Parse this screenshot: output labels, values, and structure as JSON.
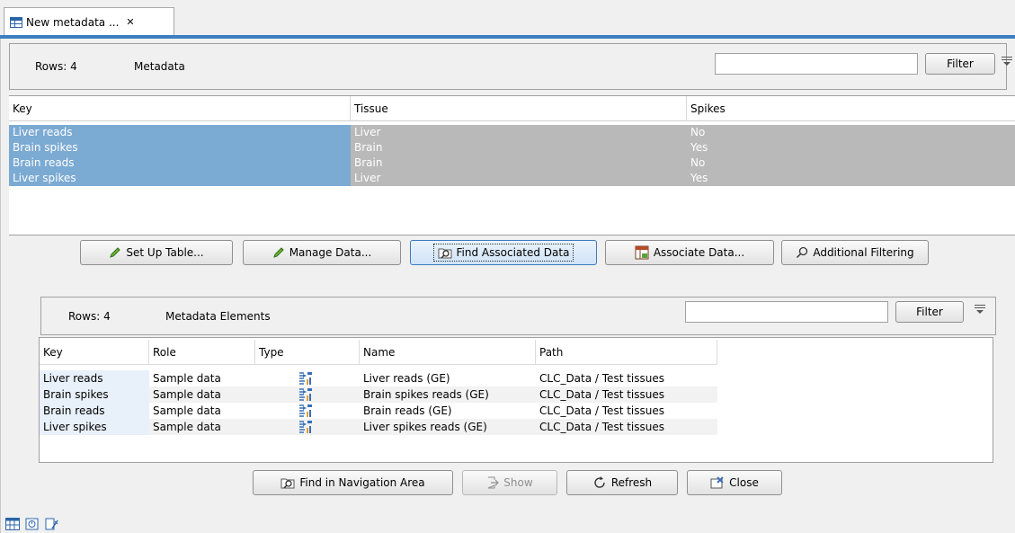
{
  "tab": {
    "title": "New metadata ...",
    "close": "✕"
  },
  "top": {
    "rows_label": "Rows: 4",
    "section_title": "Metadata",
    "filter_value": "",
    "filter_button": "Filter",
    "columns": [
      "Key",
      "Tissue",
      "Spikes"
    ],
    "rows": [
      [
        "Liver reads",
        "Liver",
        "No"
      ],
      [
        "Brain spikes",
        "Brain",
        "Yes"
      ],
      [
        "Brain reads",
        "Brain",
        "No"
      ],
      [
        "Liver spikes",
        "Liver",
        "Yes"
      ]
    ]
  },
  "actions": {
    "set_up_table": "Set Up Table...",
    "manage_data": "Manage Data...",
    "find_associated": "Find Associated Data",
    "associate_data": "Associate Data...",
    "additional_filtering": "Additional Filtering"
  },
  "lower": {
    "rows_label": "Rows: 4",
    "section_title": "Metadata Elements",
    "filter_value": "",
    "filter_button": "Filter",
    "columns": [
      "Key",
      "Role",
      "Type",
      "Name",
      "Path"
    ],
    "rows": [
      {
        "key": "Liver reads",
        "role": "Sample data",
        "type_icon": "sequence-list-icon",
        "name": "Liver reads (GE)",
        "path": "CLC_Data / Test tissues"
      },
      {
        "key": "Brain spikes",
        "role": "Sample data",
        "type_icon": "sequence-list-icon",
        "name": "Brain spikes reads (GE)",
        "path": "CLC_Data / Test tissues"
      },
      {
        "key": "Brain reads",
        "role": "Sample data",
        "type_icon": "sequence-list-icon",
        "name": "Brain reads (GE)",
        "path": "CLC_Data / Test tissues"
      },
      {
        "key": "Liver spikes",
        "role": "Sample data",
        "type_icon": "sequence-list-icon",
        "name": "Liver spikes reads (GE)",
        "path": "CLC_Data / Test tissues"
      }
    ],
    "buttons": {
      "find_nav": "Find in Navigation Area",
      "show": "Show",
      "refresh": "Refresh",
      "close": "Close"
    }
  },
  "colors": {
    "accent": "#3c7fc0",
    "selected_key": "#7baad3",
    "selected_other": "#b9b9b9"
  }
}
